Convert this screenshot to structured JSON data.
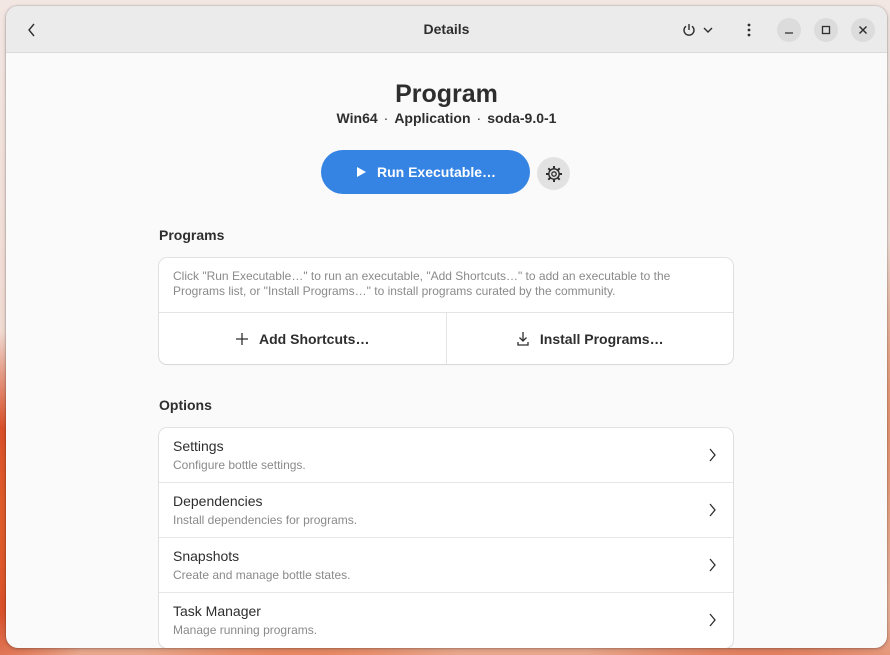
{
  "window": {
    "title": "Details"
  },
  "header": {
    "title": "Program",
    "subtitle": {
      "arch": "Win64",
      "type": "Application",
      "runner": "soda-9.0-1",
      "separator": "·"
    }
  },
  "actions": {
    "run_label": "Run Executable…"
  },
  "programs": {
    "section_title": "Programs",
    "description": "Click \"Run Executable…\" to run an executable, \"Add Shortcuts…\" to add an executable to the Programs list, or \"Install Programs…\" to install programs curated by the community.",
    "add_shortcuts_label": "Add Shortcuts…",
    "install_programs_label": "Install Programs…"
  },
  "options": {
    "section_title": "Options",
    "items": [
      {
        "title": "Settings",
        "subtitle": "Configure bottle settings."
      },
      {
        "title": "Dependencies",
        "subtitle": "Install dependencies for programs."
      },
      {
        "title": "Snapshots",
        "subtitle": "Create and manage bottle states."
      },
      {
        "title": "Task Manager",
        "subtitle": "Manage running programs."
      }
    ]
  },
  "colors": {
    "accent": "#3584e4",
    "window_bg": "#fafafa",
    "headerbar_bg": "#ebebeb"
  },
  "icons": {
    "back": "chevron-left-icon",
    "power": "power-icon",
    "dropdown": "chevron-down-icon",
    "menu": "vertical-dots-icon",
    "minimize": "minimize-icon",
    "maximize": "maximize-icon",
    "close": "close-icon",
    "run": "play-icon",
    "settings": "gear-icon",
    "add": "plus-icon",
    "install": "download-icon",
    "row_chevron": "chevron-right-icon"
  }
}
